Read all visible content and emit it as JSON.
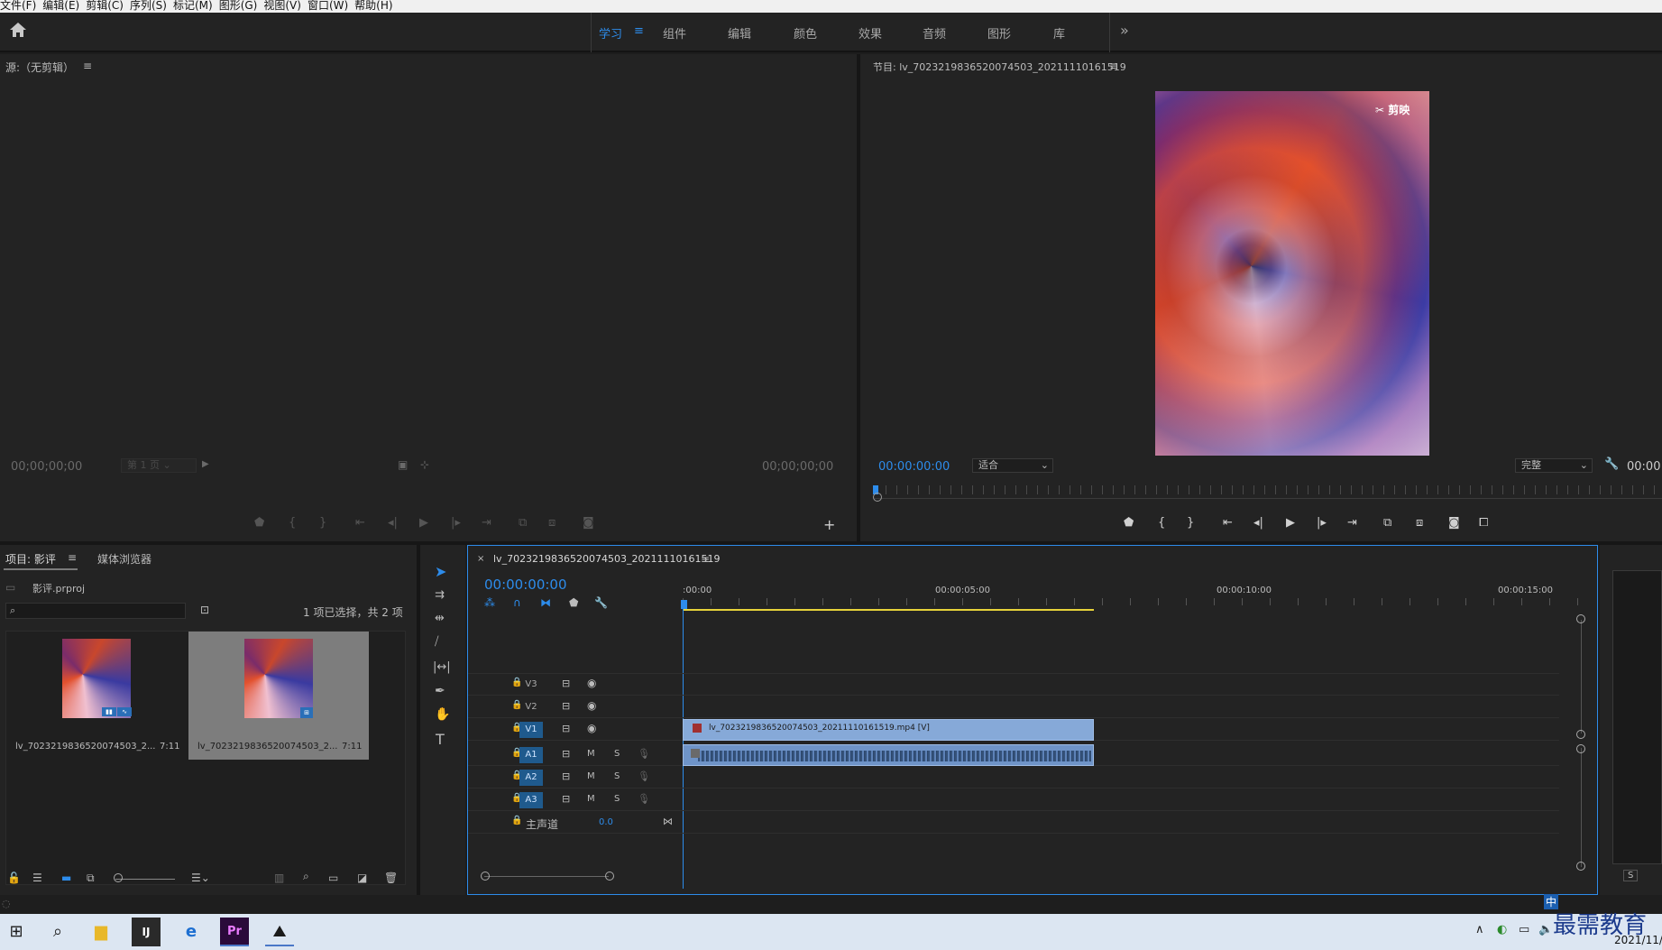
{
  "menu": [
    "文件(F)",
    "编辑(E)",
    "剪辑(C)",
    "序列(S)",
    "标记(M)",
    "图形(G)",
    "视图(V)",
    "窗口(W)",
    "帮助(H)"
  ],
  "workspaces": {
    "active": "学习",
    "tabs": [
      "组件",
      "编辑",
      "颜色",
      "效果",
      "音频",
      "图形",
      "库"
    ]
  },
  "source_monitor": {
    "title": "源:（无剪辑）",
    "timecode_left": "00;00;00;00",
    "page_select": "第 1 页",
    "timecode_right": "00;00;00;00"
  },
  "program_monitor": {
    "title": "节目: lv_7023219836520074503_20211110161519",
    "timecode": "00:00:00:00",
    "fit": "适合",
    "quality": "完整",
    "duration_partial": "00:00",
    "watermark": "剪映"
  },
  "project": {
    "tab_active": "项目: 影评",
    "tab_other": "媒体浏览器",
    "file": "影评.prproj",
    "selection_info": "1 项已选择，共 2 项",
    "items": [
      {
        "name": "lv_7023219836520074503_2...",
        "duration": "7:11",
        "selected": false
      },
      {
        "name": "lv_7023219836520074503_2...",
        "duration": "7:11",
        "selected": true
      }
    ]
  },
  "timeline": {
    "sequence_name": "lv_7023219836520074503_20211110161519",
    "timecode": "00:00:00:00",
    "ruler": [
      ":00:00",
      "00:00:05:00",
      "00:00:10:00",
      "00:00:15:00"
    ],
    "video_tracks": [
      "V3",
      "V2",
      "V1"
    ],
    "audio_tracks": [
      "A1",
      "A2",
      "A3"
    ],
    "master": {
      "label": "主声道",
      "value": "0.0"
    },
    "clip_label": "lv_7023219836520074503_20211110161519.mp4 [V]",
    "mute_label": "M",
    "solo_label": "S"
  },
  "right_panel": {
    "solo": "S"
  },
  "taskbar": {
    "date": "2021/11/",
    "ime": "中",
    "overlay_brand": "最需教育"
  },
  "colors": {
    "accent": "#2d8ceb",
    "clip_video": "#86a9d8",
    "clip_audio": "#6f94c8",
    "work_area": "#e6d23a"
  }
}
